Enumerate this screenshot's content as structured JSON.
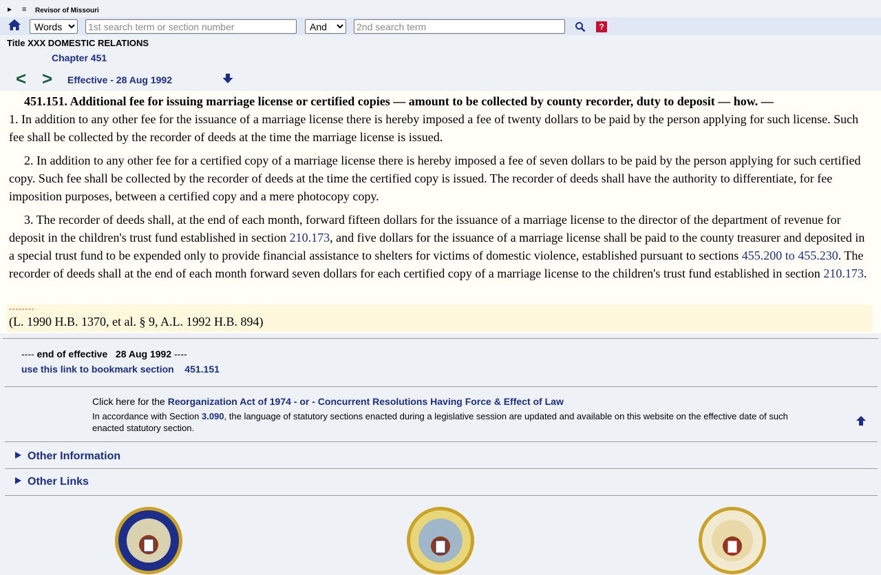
{
  "header": {
    "menu_glyph": "≡",
    "site_title": "Revisor of Missouri"
  },
  "search": {
    "mode_selected": "Words",
    "mode_options": [
      "Words"
    ],
    "term1_placeholder": "1st search term or section number",
    "conj_selected": "And",
    "conj_options": [
      "And"
    ],
    "term2_placeholder": "2nd search term",
    "help_label": "?"
  },
  "breadcrumb": {
    "title": "Title XXX DOMESTIC RELATIONS",
    "chapter": "Chapter 451"
  },
  "nav": {
    "prev": "<",
    "next": ">",
    "effective": "Effective - 28 Aug 1992"
  },
  "law": {
    "heading": "451.151.  Additional fee for issuing marriage license or certified copies — amount to be collected by county recorder, duty to deposit — how. —",
    "p1": "1.  In addition to any other fee for the issuance of a marriage license there is hereby imposed a fee of twenty dollars to be paid by the person applying for such license.  Such fee shall be collected by the recorder of deeds at the time the marriage license is issued.",
    "p2": "2.  In addition to any other fee for a certified copy of a marriage license there is hereby imposed a fee of seven dollars to be paid by the person applying for such certified copy.  Such fee shall be collected by the recorder of deeds at the time the certified copy is issued.  The recorder of deeds shall have the authority to differentiate, for fee imposition purposes, between a certified copy and a mere photocopy copy.",
    "p3_a": "3.  The recorder of deeds shall, at the end of each month, forward fifteen dollars for the issuance of a marriage license to the director of the department of revenue for deposit in the children's trust fund established in section ",
    "p3_link1": "210.173",
    "p3_b": ", and five dollars for the issuance of a marriage license shall be paid to the county treasurer and deposited in a special trust fund to be expended only to provide financial assistance to shelters for victims of domestic violence, established pursuant to sections ",
    "p3_link2": "455.200 to 455.230",
    "p3_c": ".  The recorder of deeds shall at the end of each month forward seven dollars for each certified copy of a marriage license to the children's trust fund established in section ",
    "p3_link3": "210.173",
    "p3_d": ".",
    "dashes": "--------",
    "history": "(L. 1990 H.B. 1370, et al. § 9, A.L. 1992 H.B. 894)"
  },
  "footer": {
    "end_prefix": "---- ",
    "end_label": "end of effective",
    "end_date": "28 Aug 1992",
    "end_suffix": " ----",
    "bookmark_label": "use this link to bookmark section",
    "bookmark_section": "451.151",
    "click_prefix": "Click here for the ",
    "reorg_link": "Reorganization Act of 1974",
    "or_text": " - or - ",
    "concurrent_link": "Concurrent Resolutions Having Force & Effect of Law",
    "accord_prefix": "In accordance with Section ",
    "accord_link": "3.090",
    "accord_text": ", the language of statutory sections enacted during a legislative session are updated and available on this website on the effective date of such enacted statutory section.",
    "other_information": "Other Information",
    "other_links": "Other Links"
  },
  "colors": {
    "link": "#1c2e8a",
    "nav_arrow": "#1d5c3a",
    "help_bg": "#c8102e",
    "law_bg": "#fffff7",
    "history_bg": "#fff8dc"
  }
}
